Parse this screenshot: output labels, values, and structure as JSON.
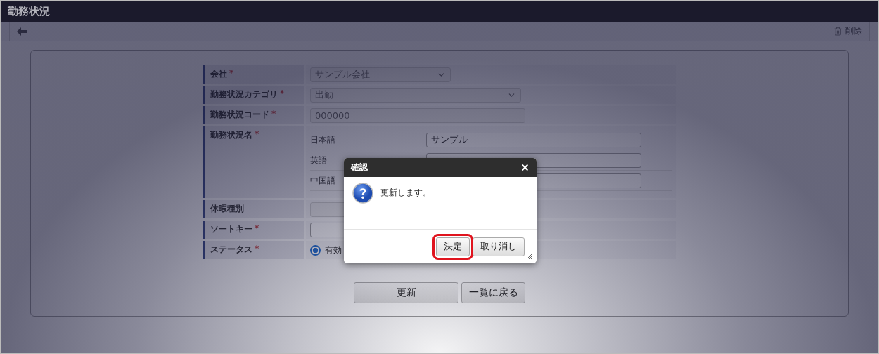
{
  "header": {
    "title": "勤務状況"
  },
  "toolbar": {
    "delete_label": "削除"
  },
  "form": {
    "rows": [
      {
        "kind": "select",
        "label": "会社",
        "required_mark": "*",
        "value": "サンプル会社",
        "disabled": true
      },
      {
        "kind": "select",
        "label": "勤務状況カテゴリ",
        "required_mark": "*",
        "value": "出勤",
        "disabled": true
      },
      {
        "kind": "text",
        "label": "勤務状況コード",
        "required_mark": "*",
        "value": "000000",
        "disabled": true
      },
      {
        "kind": "multilang",
        "label": "勤務状況名",
        "required_mark": "*",
        "languages": [
          {
            "label": "日本語",
            "value": "サンプル"
          },
          {
            "label": "英語"
          },
          {
            "label": "中国語"
          }
        ]
      },
      {
        "kind": "text",
        "label": "休暇種別",
        "disabled": true
      },
      {
        "kind": "text",
        "label": "ソートキー",
        "required_mark": "*",
        "disabled": false
      },
      {
        "kind": "radio",
        "label": "ステータス",
        "required_mark": "*",
        "options": [
          {
            "label": "有効",
            "selected": true
          }
        ]
      }
    ]
  },
  "actions": [
    "更新",
    "一覧に戻る"
  ],
  "dialog": {
    "title": "確認",
    "message": "更新します。",
    "buttons": [
      {
        "label": "決定",
        "highlighted": true
      },
      {
        "label": "取り消し",
        "highlighted": false
      }
    ]
  }
}
